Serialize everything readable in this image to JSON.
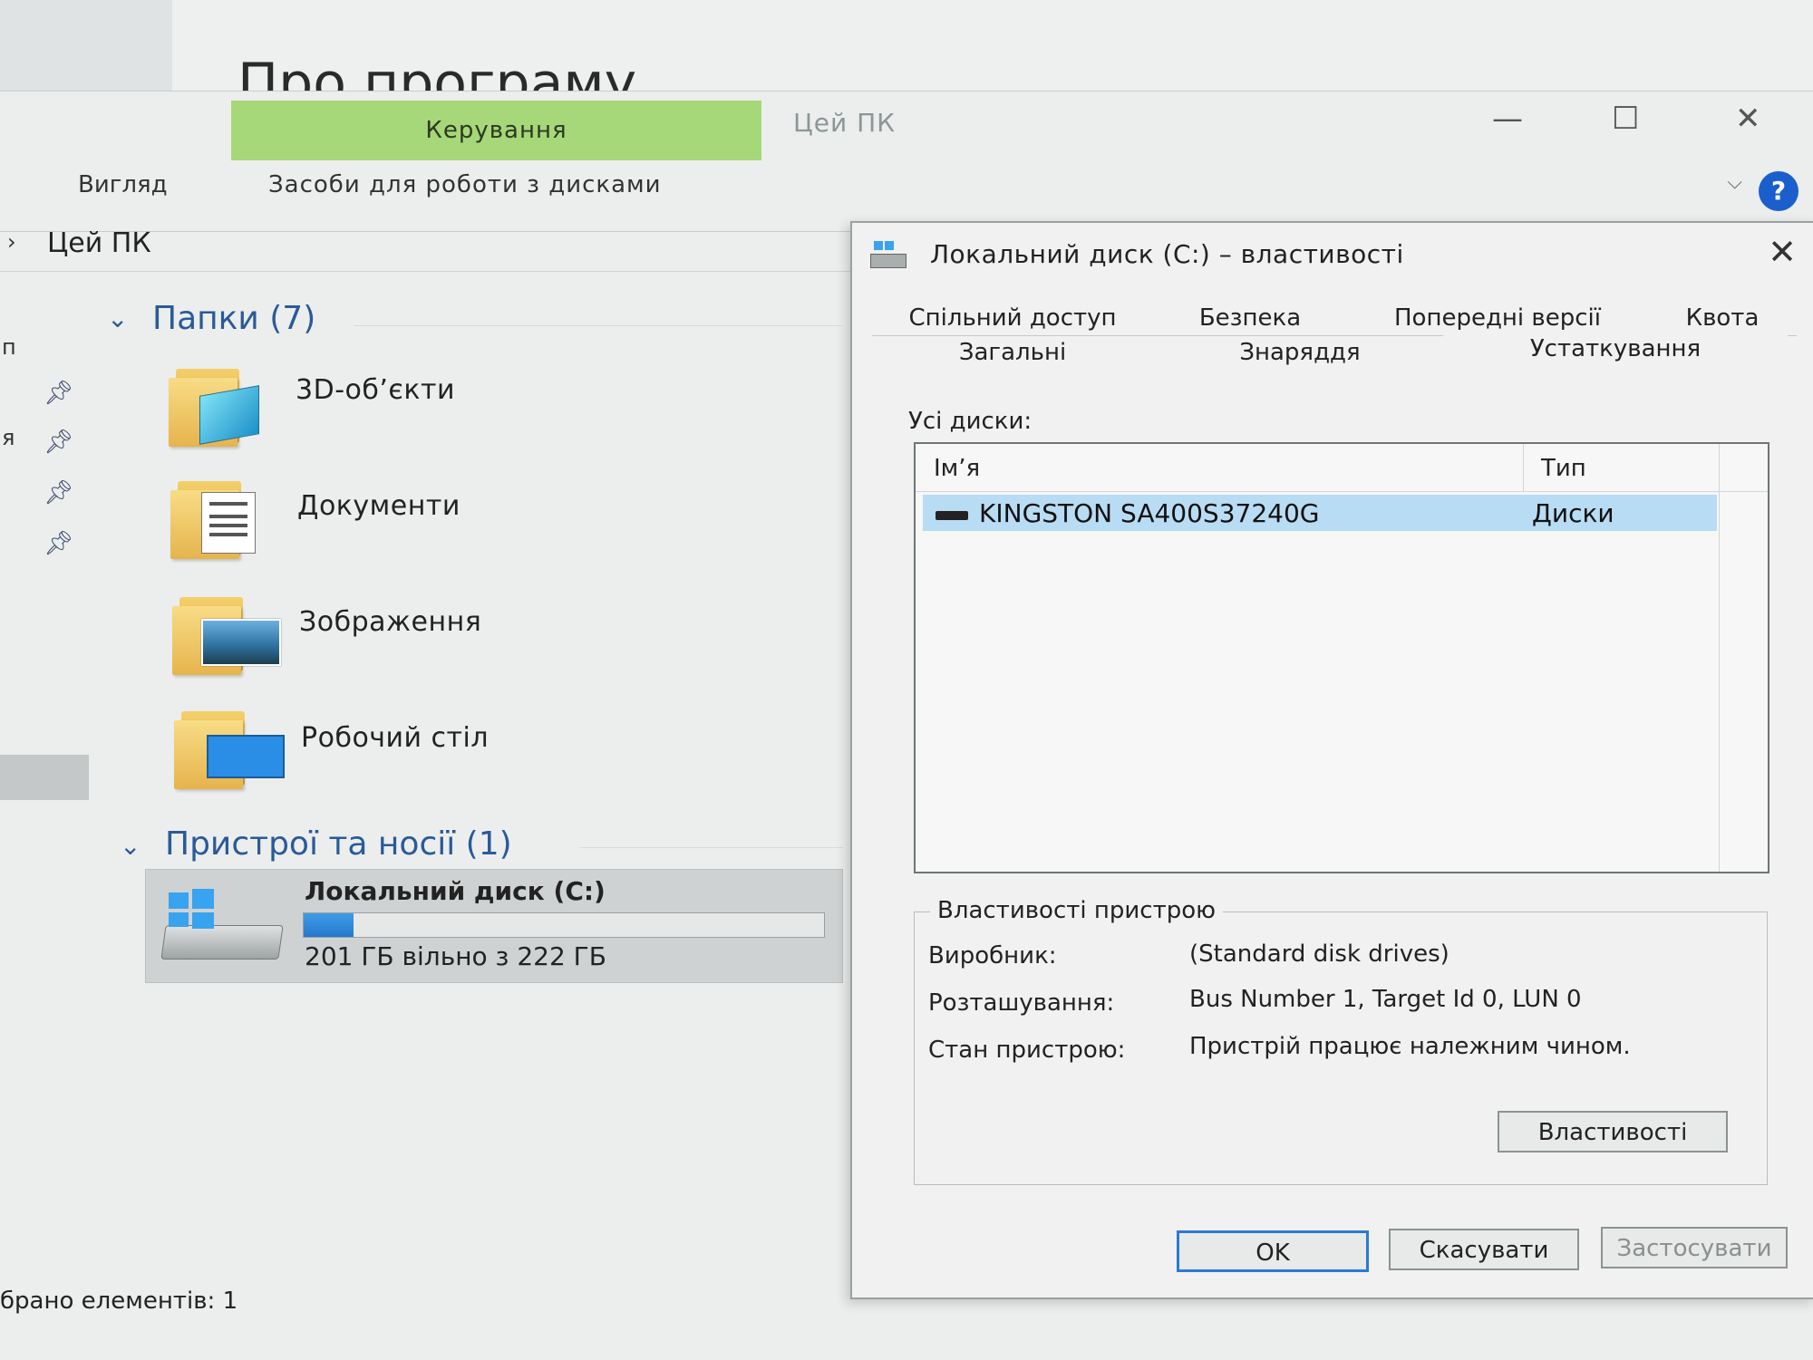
{
  "background_window": {
    "title": "Про програму"
  },
  "ribbon": {
    "manage_tab": "Керування",
    "thispc_tab": "Цей ПК",
    "view_tab": "Вигляд",
    "disk_tools_tab": "Засоби для роботи з дисками",
    "minimize": "—",
    "maximize": "☐",
    "close": "✕",
    "help": "?"
  },
  "address": {
    "arrow": "›",
    "path": "Цей ПК"
  },
  "nav": {
    "frag1": "п",
    "frag2": "я"
  },
  "folders_group": {
    "title": "Папки (7)",
    "items": [
      {
        "label": "3D-об’єкти"
      },
      {
        "label": "Документи"
      },
      {
        "label": "Зображення"
      },
      {
        "label": "Робочий стіл"
      }
    ]
  },
  "devices_group": {
    "title": "Пристрої та носії (1)",
    "drive": {
      "label": "Локальний диск (C:)",
      "free_text": "201 ГБ вільно з 222 ГБ",
      "used_fraction": 0.095
    }
  },
  "status_bar": {
    "text": "брано елементів: 1"
  },
  "dialog": {
    "title": "Локальний диск (C:) – властивості",
    "close": "✕",
    "tabs_row1": [
      "Спільний доступ",
      "Безпека",
      "Попередні версії",
      "Квота"
    ],
    "tabs_row2": [
      "Загальні",
      "Знаряддя",
      "Устаткування"
    ],
    "selected_tab": "Устаткування",
    "all_disks_label": "Усі диски:",
    "columns": {
      "name": "Ім’я",
      "type": "Тип"
    },
    "rows": [
      {
        "name": "KINGSTON SA400S37240G",
        "type": "Диски"
      }
    ],
    "device_props": {
      "caption": "Властивості пристрою",
      "manufacturer_label": "Виробник:",
      "manufacturer_value": "(Standard disk drives)",
      "location_label": "Розташування:",
      "location_value": "Bus Number 1, Target Id 0, LUN 0",
      "status_label": "Стан пристрою:",
      "status_value": "Пристрій працює належним чином.",
      "properties_button": "Властивості"
    },
    "buttons": {
      "ok": "OK",
      "cancel": "Скасувати",
      "apply": "Застосувати"
    }
  }
}
